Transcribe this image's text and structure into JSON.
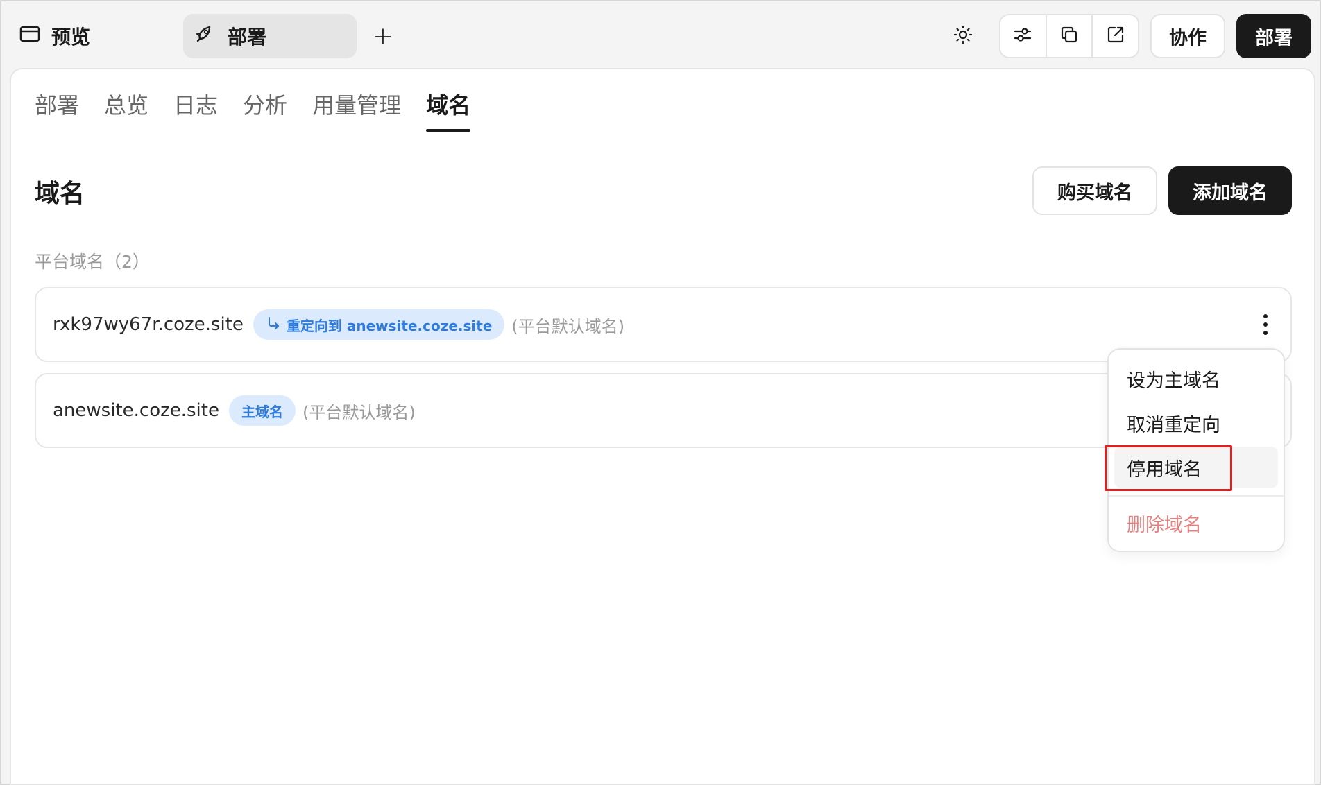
{
  "topbar": {
    "preview_label": "预览",
    "deploy_tab_label": "部署",
    "add_tab_symbol": "+",
    "collab_label": "协作",
    "deploy_button_label": "部署"
  },
  "subtabs": [
    {
      "label": "部署"
    },
    {
      "label": "总览"
    },
    {
      "label": "日志"
    },
    {
      "label": "分析"
    },
    {
      "label": "用量管理"
    },
    {
      "label": "域名",
      "active": true
    }
  ],
  "section": {
    "title": "域名",
    "buy_label": "购买域名",
    "add_label": "添加域名",
    "group_label": "平台域名（2）"
  },
  "domains": [
    {
      "name": "rxk97wy67r.coze.site",
      "badge": "重定向到 anewsite.coze.site",
      "hint": "(平台默认域名)"
    },
    {
      "name": "anewsite.coze.site",
      "badge": "主域名",
      "hint": "(平台默认域名)"
    }
  ],
  "menu": {
    "items": [
      {
        "label": "设为主域名"
      },
      {
        "label": "取消重定向"
      },
      {
        "label": "停用域名"
      },
      {
        "label": "删除域名"
      }
    ]
  },
  "colors": {
    "accent_dark": "#1a1a1a",
    "badge_bg": "#dbeafd",
    "badge_text": "#2f7bdc",
    "danger": "#e58080",
    "highlight": "#e02020"
  }
}
